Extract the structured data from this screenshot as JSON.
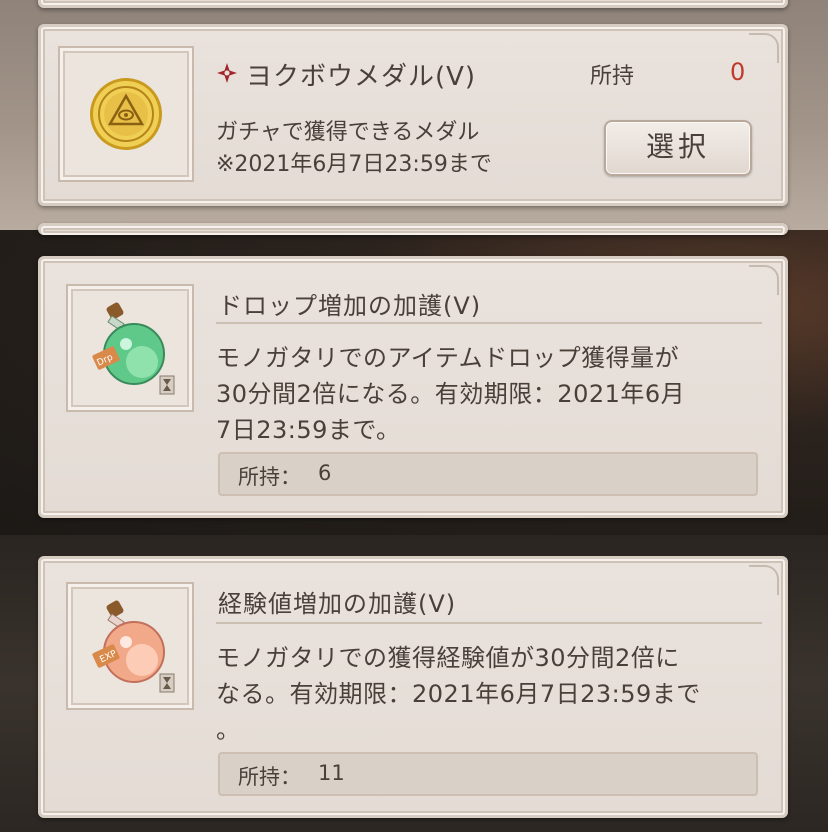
{
  "colors": {
    "count_zero": "#c0392b",
    "marker": "#a3262e"
  },
  "medal": {
    "name": "ヨクボウメダル(Ⅴ)",
    "owned_label": "所持",
    "owned_value": "0",
    "description_1": "ガチャで獲得できるメダル",
    "description_2": "※2021年6月7日23:59まで",
    "select_label": "選択",
    "icon": "gold-medal-icon"
  },
  "items": [
    {
      "title": "ドロップ増加の加護(Ⅴ)",
      "desc_1": "モノガタリでのアイテムドロップ獲得量が",
      "desc_2": "30分間2倍になる。有効期限：2021年6月",
      "desc_3": "7日23:59まで。",
      "stock_label": "所持：",
      "stock_value": "6",
      "icon": "green-drop-potion-icon"
    },
    {
      "title": "経験値増加の加護(Ⅴ)",
      "desc_1": "モノガタリでの獲得経験値が30分間2倍に",
      "desc_2": "なる。有効期限：2021年6月7日23:59まで",
      "desc_3": "。",
      "stock_label": "所持：",
      "stock_value": "11",
      "icon": "pink-exp-potion-icon"
    }
  ]
}
